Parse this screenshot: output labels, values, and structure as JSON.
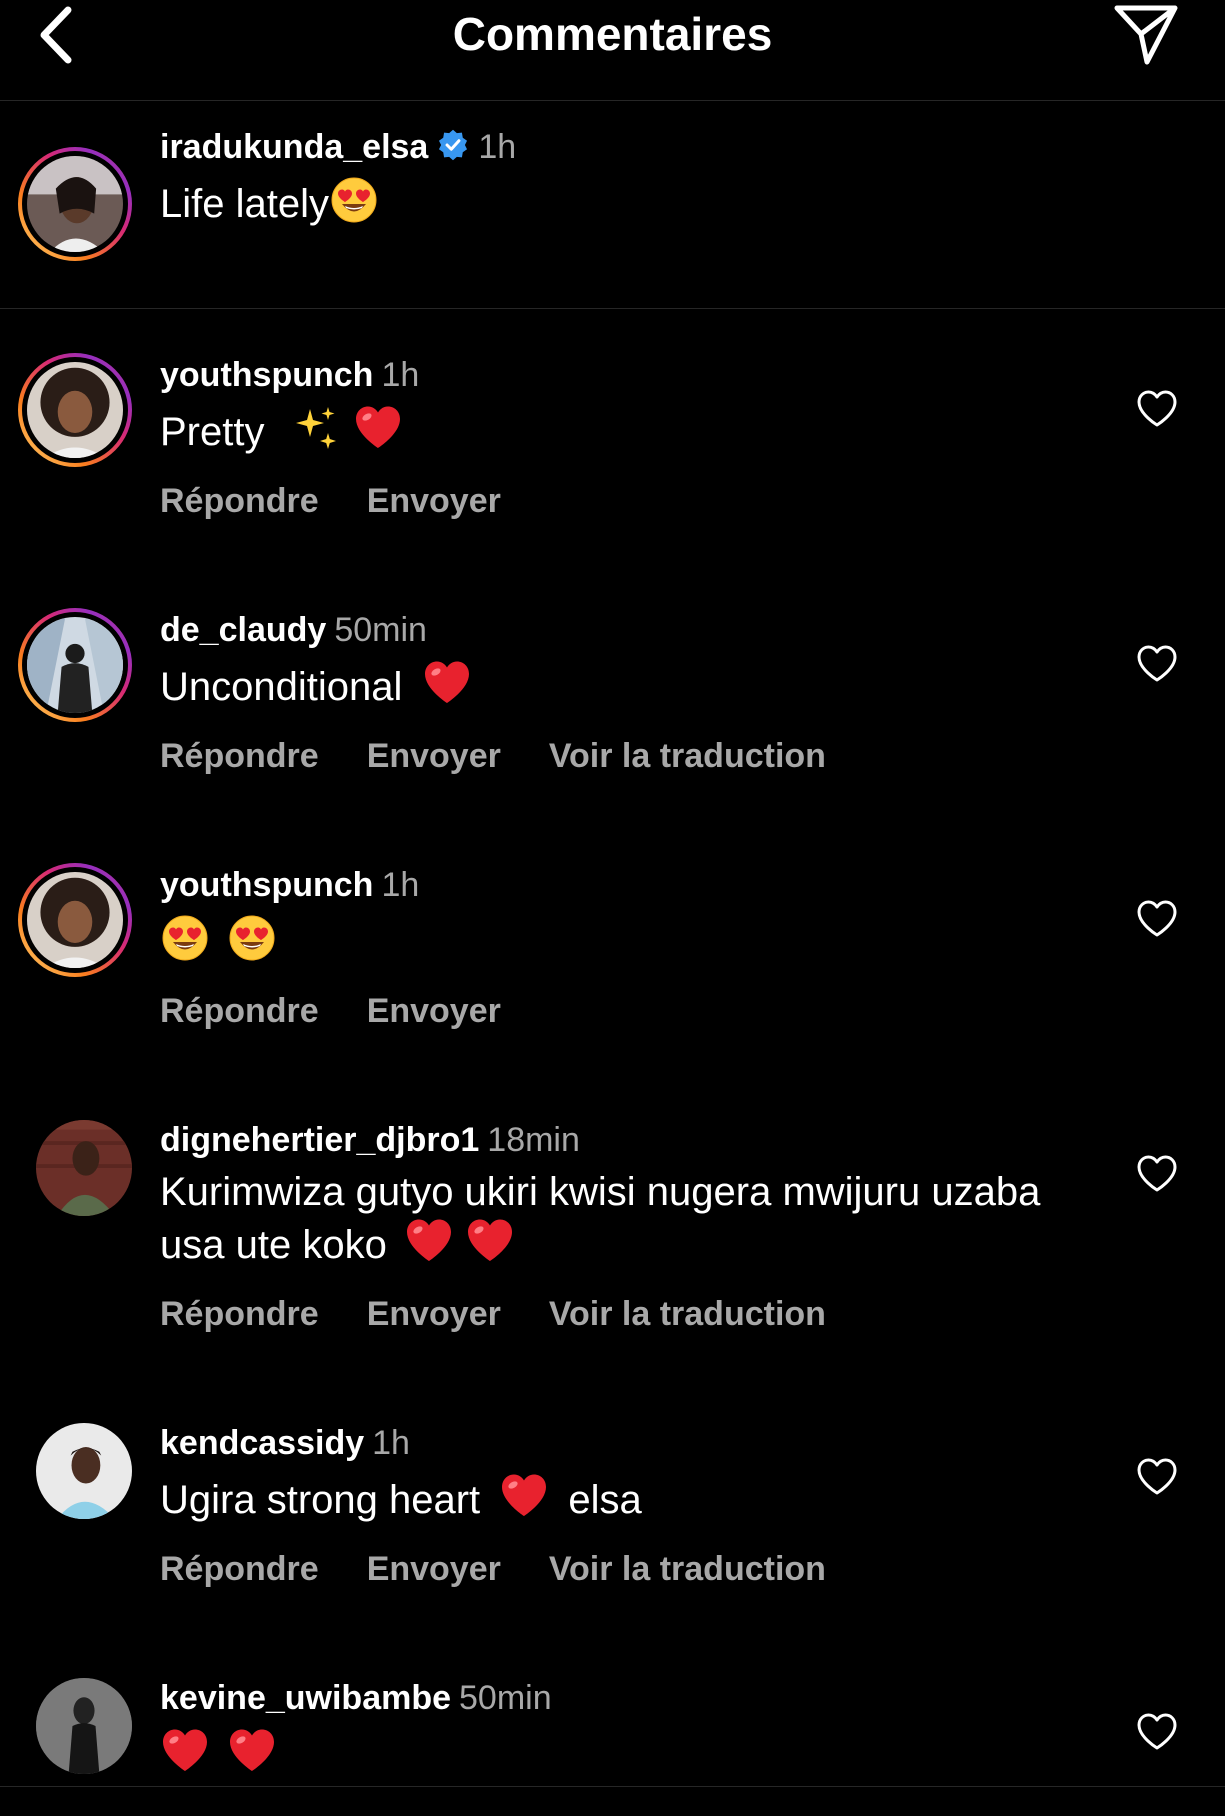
{
  "header": {
    "title": "Commentaires"
  },
  "caption": {
    "username": "iradukunda_elsa",
    "time": "1h",
    "text": "Life lately"
  },
  "actions": {
    "reply": "Répondre",
    "send": "Envoyer",
    "translate": "Voir la traduction"
  },
  "comments": [
    {
      "username": "youthspunch",
      "time": "1h",
      "text": "Pretty"
    },
    {
      "username": "de_claudy",
      "time": "50min",
      "text": "Unconditional"
    },
    {
      "username": "youthspunch",
      "time": "1h",
      "text": ""
    },
    {
      "username": "dignehertier_djbro1",
      "time": "18min",
      "text": "Kurimwiza gutyo ukiri kwisi nugera mwijuru uzaba usa ute koko"
    },
    {
      "username": "kendcassidy",
      "time": "1h",
      "text_a": "Ugira strong heart",
      "text_b": "elsa"
    },
    {
      "username": "kevine_uwibambe",
      "time": "50min",
      "text": ""
    }
  ],
  "colors": {
    "background": "#000000",
    "secondary_text": "#a8a8a8",
    "verified_blue": "#3897f0",
    "divider": "#262626"
  }
}
